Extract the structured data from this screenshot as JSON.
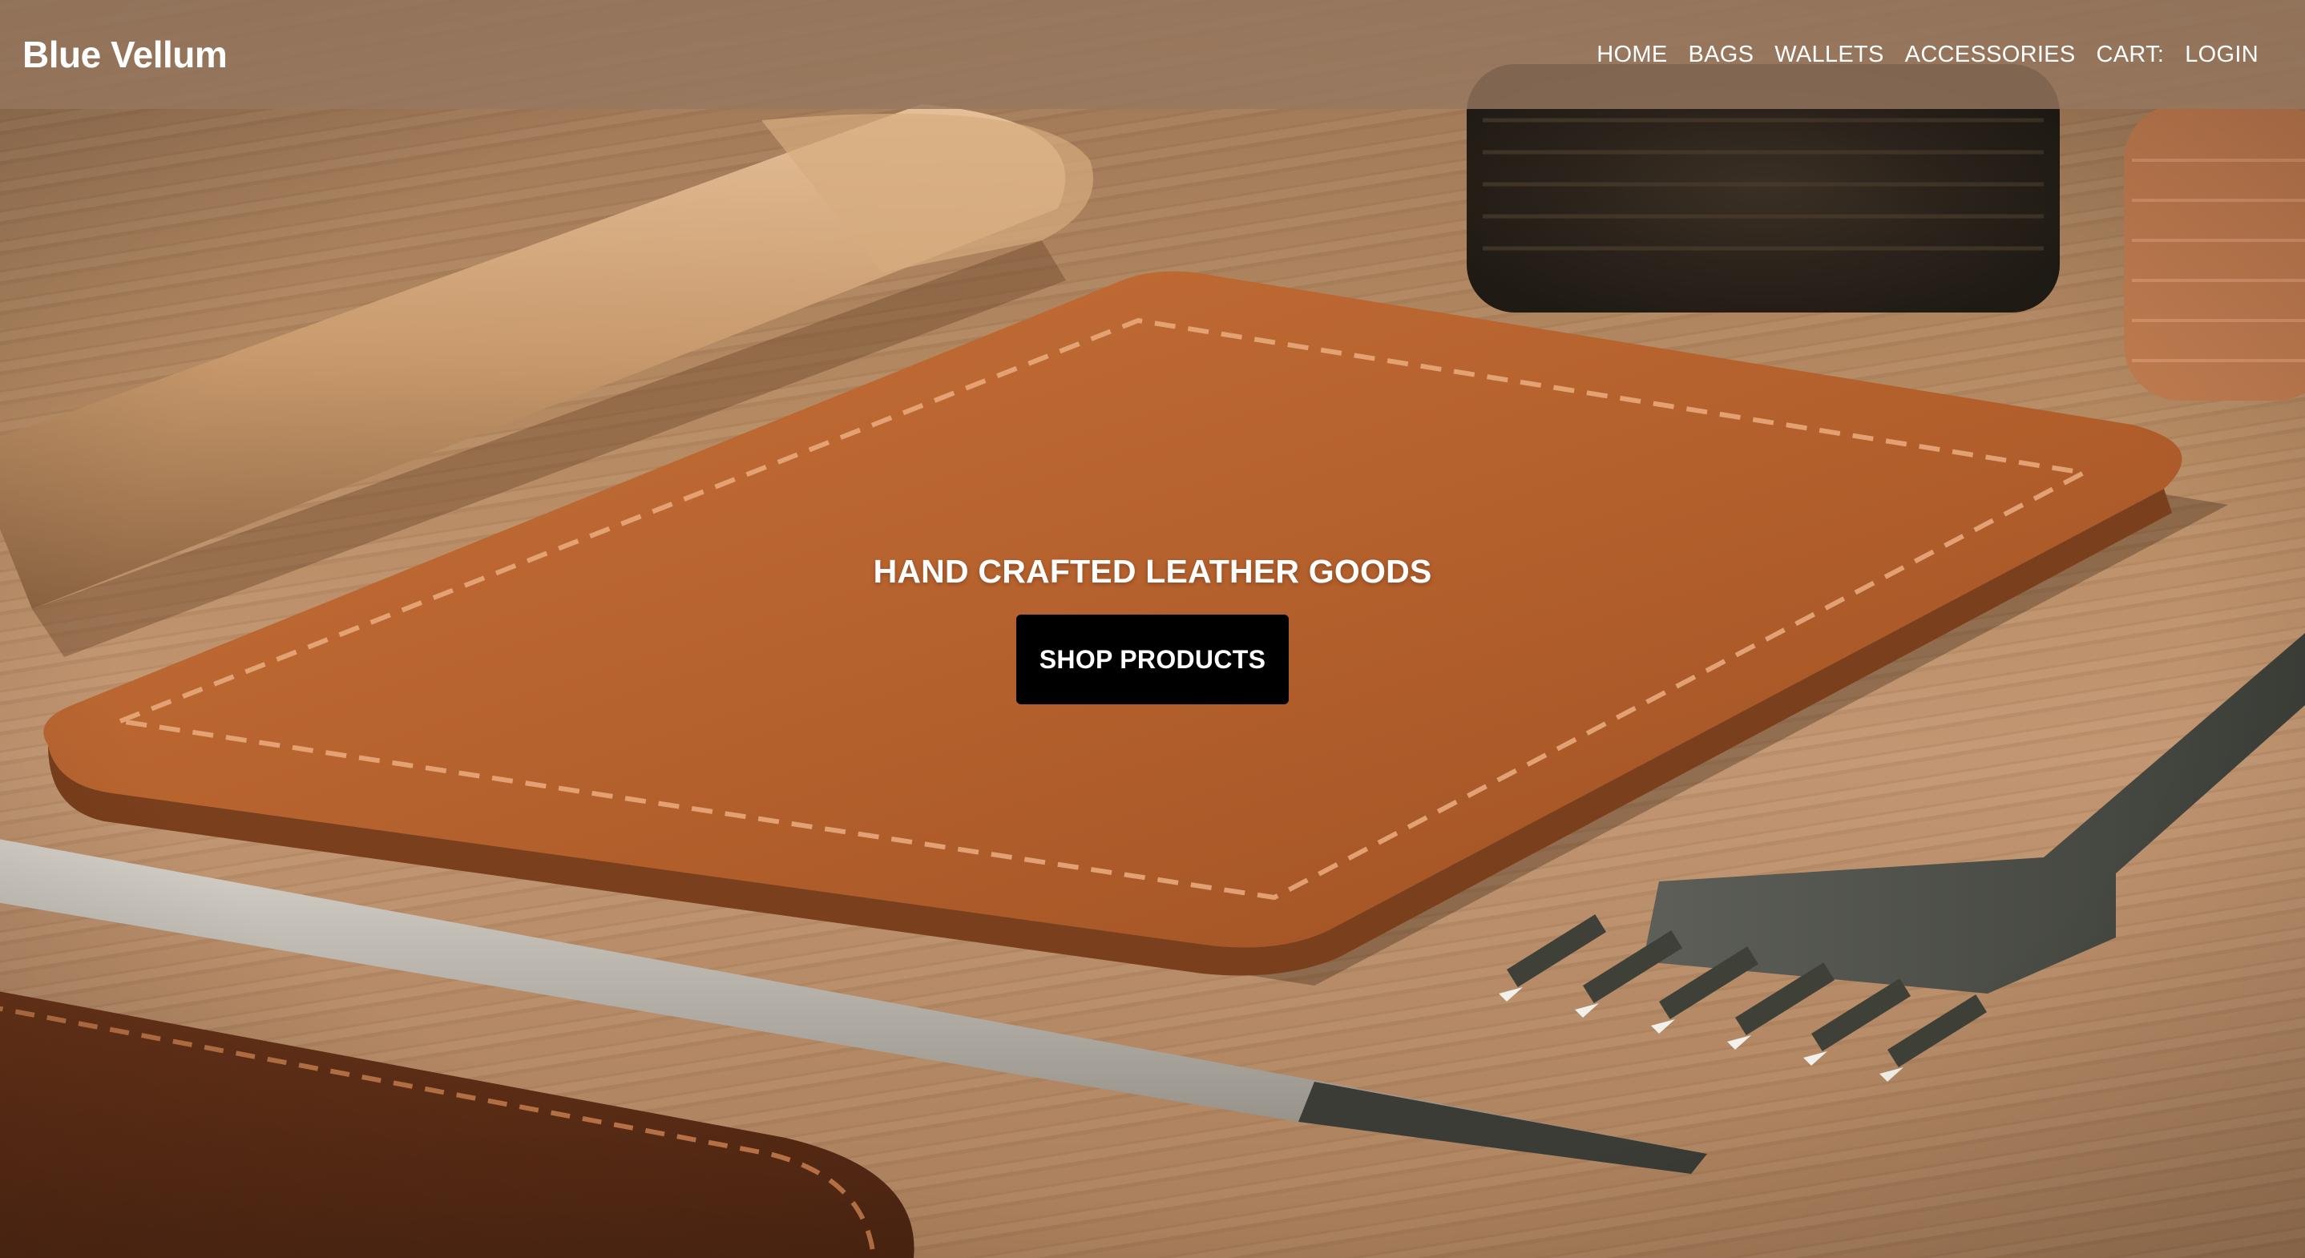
{
  "brand": {
    "name": "Blue Vellum"
  },
  "nav": {
    "items": [
      {
        "label": "HOME"
      },
      {
        "label": "BAGS"
      },
      {
        "label": "WALLETS"
      },
      {
        "label": "ACCESSORIES"
      },
      {
        "label": "CART:"
      },
      {
        "label": "LOGIN"
      }
    ]
  },
  "hero": {
    "title": "HAND CRAFTED LEATHER GOODS",
    "cta_label": "SHOP PRODUCTS",
    "background_image": "leather wallet on wooden workbench with leather tools"
  },
  "colors": {
    "navbar_bg": "#96785f",
    "cta_bg": "#000000",
    "text": "#ffffff",
    "leather": "#b8632f"
  }
}
